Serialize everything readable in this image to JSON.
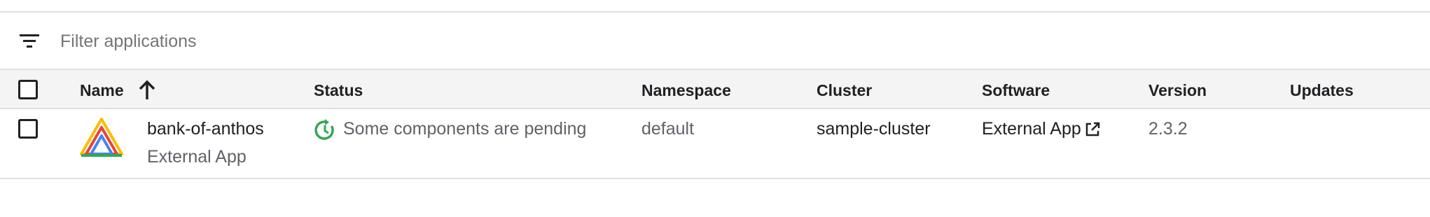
{
  "filter": {
    "icon": "filter-list-icon",
    "placeholder": "Filter applications",
    "value": ""
  },
  "table": {
    "columns": {
      "name": "Name",
      "status": "Status",
      "namespace": "Namespace",
      "cluster": "Cluster",
      "software": "Software",
      "version": "Version",
      "updates": "Updates"
    },
    "sort": {
      "column": "Name",
      "direction": "ascending",
      "icon": "arrow-upward-icon"
    },
    "rows": [
      {
        "selected": false,
        "logo_icon": "anthos-logo-icon",
        "name": "bank-of-anthos",
        "type": "External App",
        "status_icon": "pending-refresh-icon",
        "status": "Some components are pending",
        "namespace": "default",
        "cluster": "sample-cluster",
        "software": "External App",
        "software_icon": "open-in-new-icon",
        "version": "2.3.2",
        "updates": ""
      }
    ]
  },
  "colors": {
    "status_pending": "#34a853",
    "header_bg": "#f4f4f4",
    "divider": "#e0e0e0",
    "text_primary": "#202124",
    "text_secondary": "#5f6368"
  }
}
